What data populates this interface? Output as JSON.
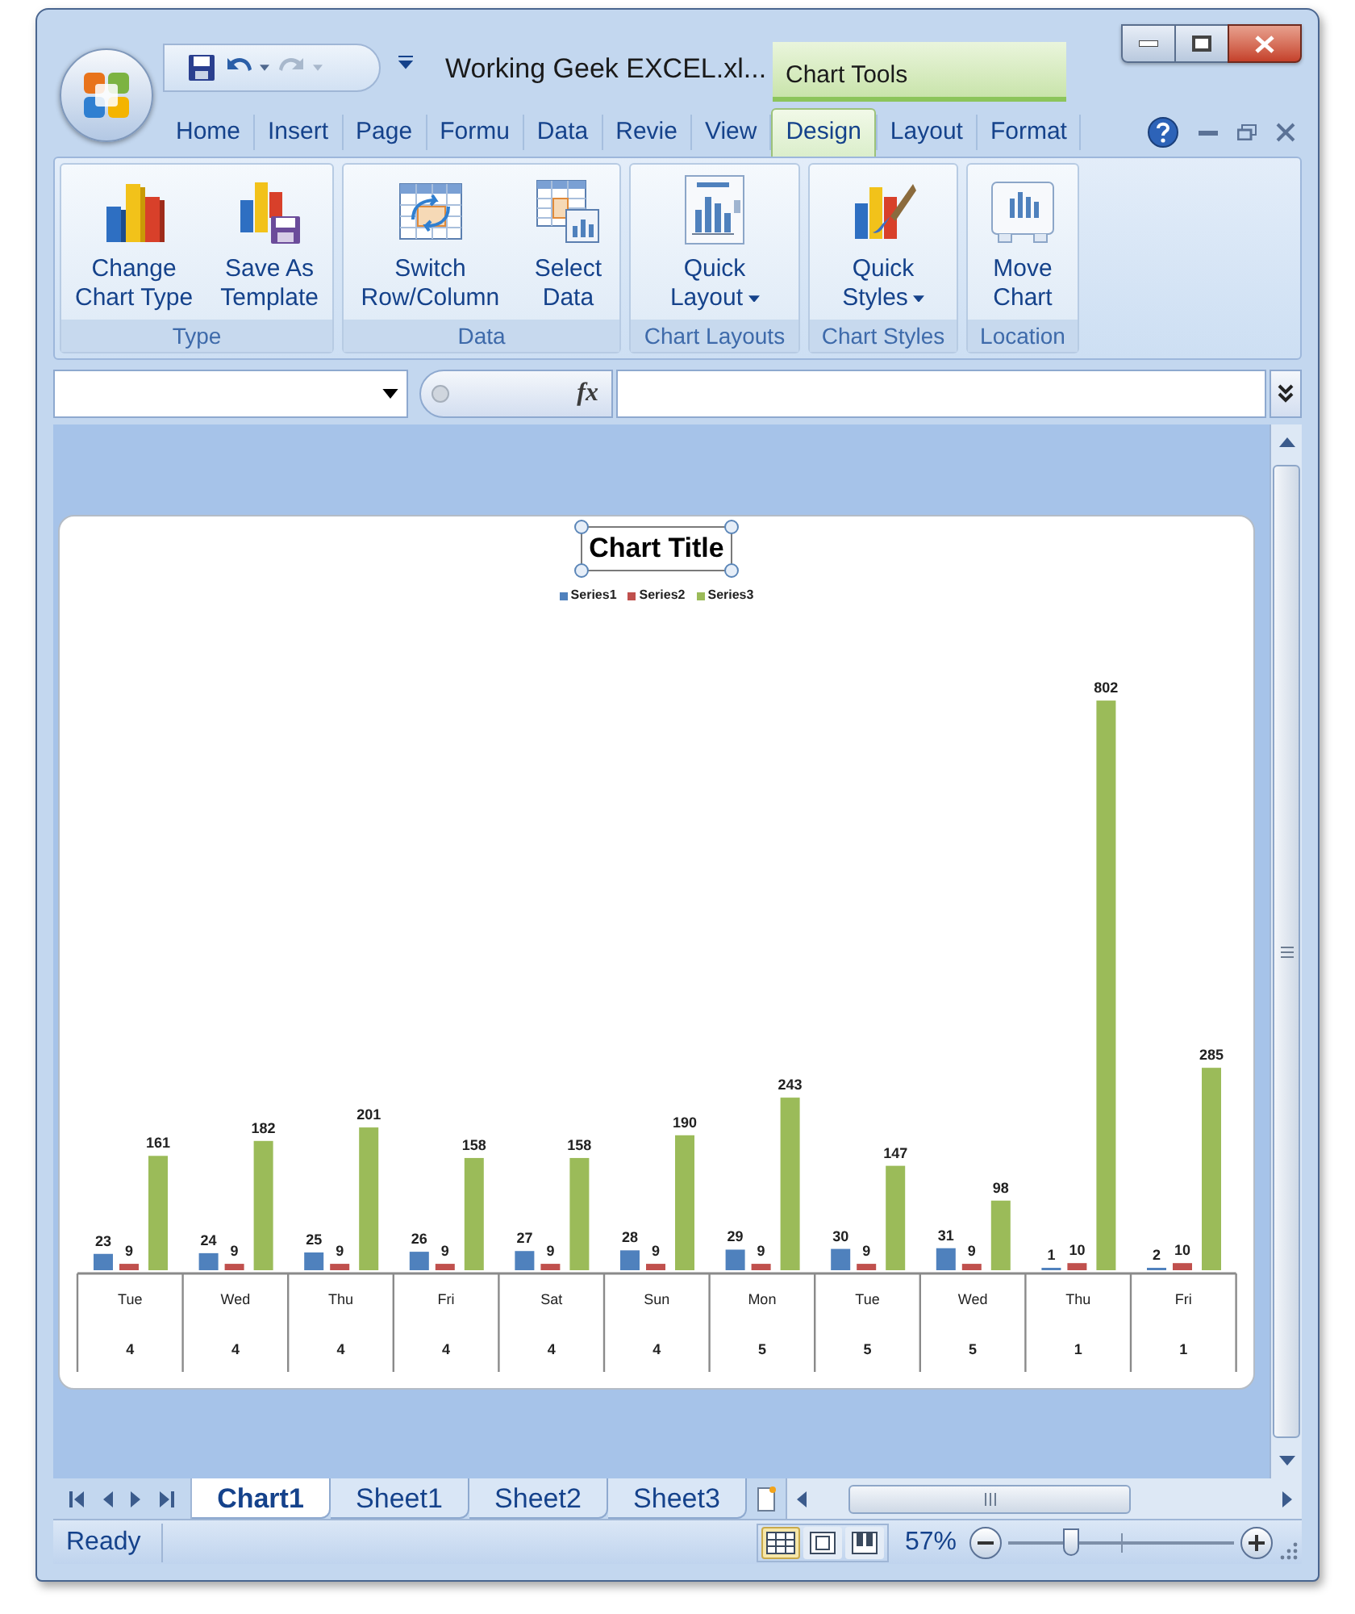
{
  "window": {
    "title": "Working Geek EXCEL.xl...",
    "context_label": "Chart Tools"
  },
  "quick_access": [
    {
      "kind": "save",
      "disabled": false
    },
    {
      "kind": "undo",
      "disabled": false
    },
    {
      "kind": "redo",
      "disabled": true
    }
  ],
  "ribbon_tabs": [
    {
      "label": "Home",
      "selected": false
    },
    {
      "label": "Insert",
      "selected": false
    },
    {
      "label": "Page",
      "selected": false
    },
    {
      "label": "Formu",
      "selected": false
    },
    {
      "label": "Data",
      "selected": false
    },
    {
      "label": "Revie",
      "selected": false
    },
    {
      "label": "View",
      "selected": false
    },
    {
      "label": "Design",
      "selected": true
    },
    {
      "label": "Layout",
      "selected": false
    },
    {
      "label": "Format",
      "selected": false
    }
  ],
  "ribbon_groups": [
    {
      "label": "Type",
      "buttons": [
        {
          "kind": "change-chart-type",
          "lines": [
            "Change",
            "Chart Type"
          ],
          "dropdown": false
        },
        {
          "kind": "save-template",
          "lines": [
            "Save As",
            "Template"
          ],
          "dropdown": false
        }
      ]
    },
    {
      "label": "Data",
      "buttons": [
        {
          "kind": "switch-row-column",
          "lines": [
            "Switch",
            "Row/Column"
          ],
          "dropdown": false
        },
        {
          "kind": "select-data",
          "lines": [
            "Select",
            "Data"
          ],
          "dropdown": false
        }
      ]
    },
    {
      "label": "Chart Layouts",
      "buttons": [
        {
          "kind": "quick-layout",
          "lines": [
            "Quick",
            "Layout"
          ],
          "dropdown": true
        }
      ]
    },
    {
      "label": "Chart Styles",
      "buttons": [
        {
          "kind": "quick-styles",
          "lines": [
            "Quick",
            "Styles"
          ],
          "dropdown": true
        }
      ]
    },
    {
      "label": "Location",
      "buttons": [
        {
          "kind": "move-chart",
          "lines": [
            "Move",
            "Chart"
          ],
          "dropdown": false
        }
      ]
    }
  ],
  "formula_bar": {
    "function_label": "fx"
  },
  "chart": {
    "chart_data": {
      "type": "bar",
      "title": "Chart Title",
      "categories": [
        "Tue",
        "Wed",
        "Thu",
        "Fri",
        "Sat",
        "Sun",
        "Mon",
        "Tue",
        "Wed",
        "Thu",
        "Fri"
      ],
      "data_labels": true,
      "series": [
        {
          "name": "Series1",
          "color": "#4f81bd",
          "values": [
            23,
            24,
            25,
            26,
            27,
            28,
            29,
            30,
            31,
            1,
            2
          ]
        },
        {
          "name": "Series2",
          "color": "#c0504d",
          "values": [
            9,
            9,
            9,
            9,
            9,
            9,
            9,
            9,
            9,
            10,
            10
          ]
        },
        {
          "name": "Series3",
          "color": "#9bbb59",
          "values": [
            161,
            182,
            201,
            158,
            158,
            190,
            243,
            147,
            98,
            802,
            285
          ]
        }
      ]
    },
    "category_groups": [
      "4",
      "4",
      "4",
      "4",
      "4",
      "4",
      "5",
      "5",
      "5",
      "1",
      "1"
    ]
  },
  "sheet_tabs": [
    {
      "label": "Chart1",
      "selected": true
    },
    {
      "label": "Sheet1",
      "selected": false
    },
    {
      "label": "Sheet2",
      "selected": false
    },
    {
      "label": "Sheet3",
      "selected": false
    }
  ],
  "status_bar": {
    "text": "Ready",
    "zoom": "57%",
    "zoom_slider": {
      "level": 0.28
    },
    "views": [
      {
        "kind": "normal",
        "selected": true
      },
      {
        "kind": "page-layout",
        "selected": false
      },
      {
        "kind": "page-break",
        "selected": false
      }
    ]
  }
}
